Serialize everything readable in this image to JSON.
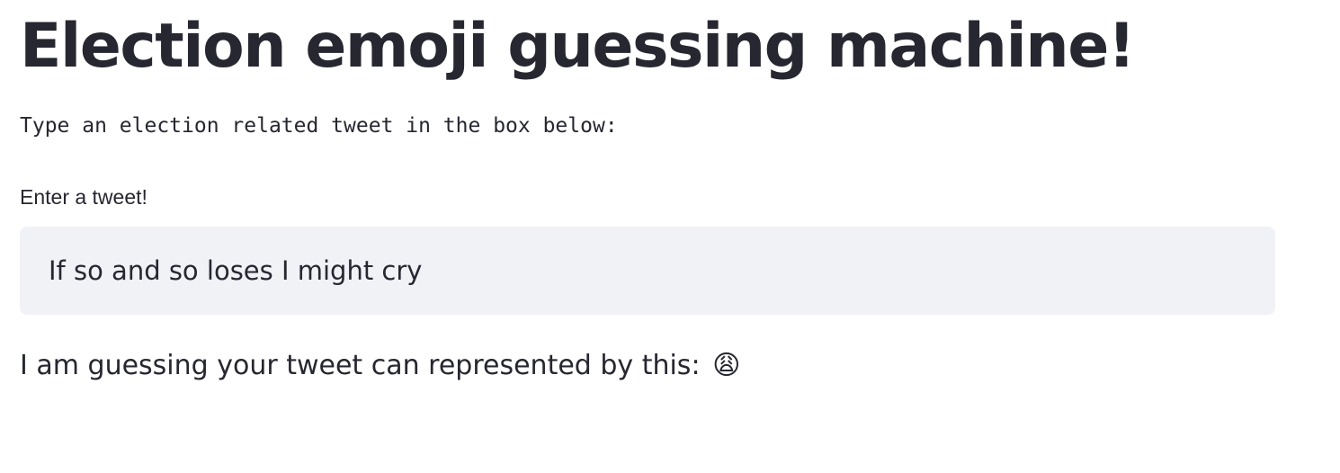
{
  "page": {
    "title": "Election emoji guessing machine!",
    "intro": "Type an election related tweet in the box below:"
  },
  "tweet_input": {
    "label": "Enter a tweet!",
    "value": "If so and so loses I might cry"
  },
  "result": {
    "text": "I am guessing your tweet can represented by this:",
    "emoji": "😩",
    "emoji_name": "weary-face-icon"
  },
  "colors": {
    "text": "#262730",
    "input_background": "#f0f2f6",
    "page_background": "#ffffff"
  }
}
